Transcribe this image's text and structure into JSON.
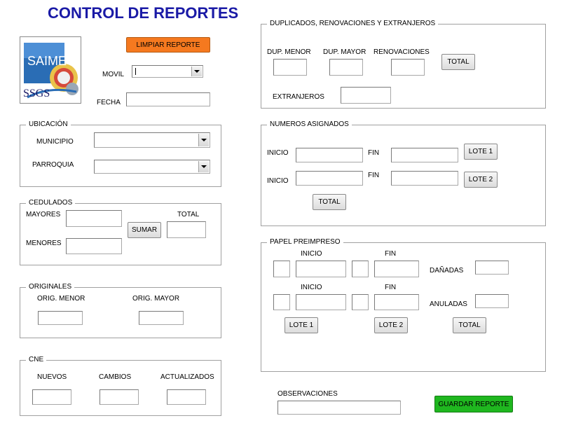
{
  "window": {
    "title": "CONTROL DE REPORTES"
  },
  "logo": {
    "top_text": "SAIME",
    "bottom_text": "SSGS"
  },
  "header": {
    "clear_button": "LIMPIAR REPORTE",
    "movil_label": "MOVIL",
    "movil_value": "",
    "fecha_label": "FECHA",
    "fecha_value": ""
  },
  "ubicacion": {
    "legend": "UBICACIÓN",
    "municipio_label": "MUNICIPIO",
    "municipio_value": "",
    "parroquia_label": "PARROQUIA",
    "parroquia_value": ""
  },
  "cedulados": {
    "legend": "CEDULADOS",
    "mayores_label": "MAYORES",
    "menores_label": "MENORES",
    "sumar_button": "SUMAR",
    "total_label": "TOTAL"
  },
  "originales": {
    "legend": "ORIGINALES",
    "menor_label": "ORIG. MENOR",
    "mayor_label": "ORIG. MAYOR"
  },
  "cne": {
    "legend": "CNE",
    "nuevos_label": "NUEVOS",
    "cambios_label": "CAMBIOS",
    "actualizados_label": "ACTUALIZADOS"
  },
  "duplicados": {
    "legend": "DUPLICADOS, RENOVACIONES Y EXTRANJEROS",
    "dup_menor_label": "DUP. MENOR",
    "dup_mayor_label": "DUP. MAYOR",
    "renovaciones_label": "RENOVACIONES",
    "total_button": "TOTAL",
    "extranjeros_label": "EXTRANJEROS"
  },
  "numeros": {
    "legend": "NUMEROS ASIGNADOS",
    "inicio1_label": "INICIO",
    "fin1_label": "FIN",
    "lote1_button": "LOTE 1",
    "inicio2_label": "INICIO",
    "fin2_label": "FIN",
    "lote2_button": "LOTE 2",
    "total_button": "TOTAL"
  },
  "papel": {
    "legend": "PAPEL PREIMPRESO",
    "inicio1_label": "INICIO",
    "fin1_label": "FIN",
    "danadas_label": "DAÑADAS",
    "inicio2_label": "INICIO",
    "fin2_label": "FIN",
    "anuladas_label": "ANULADAS",
    "lote1_button": "LOTE 1",
    "lote2_button": "LOTE 2",
    "total_button": "TOTAL"
  },
  "footer": {
    "observaciones_label": "OBSERVACIONES",
    "save_button": "GUARDAR REPORTE"
  },
  "colors": {
    "title": "#1a1aa6",
    "clear_button": "#f5791f",
    "save_button": "#1fb71f"
  }
}
